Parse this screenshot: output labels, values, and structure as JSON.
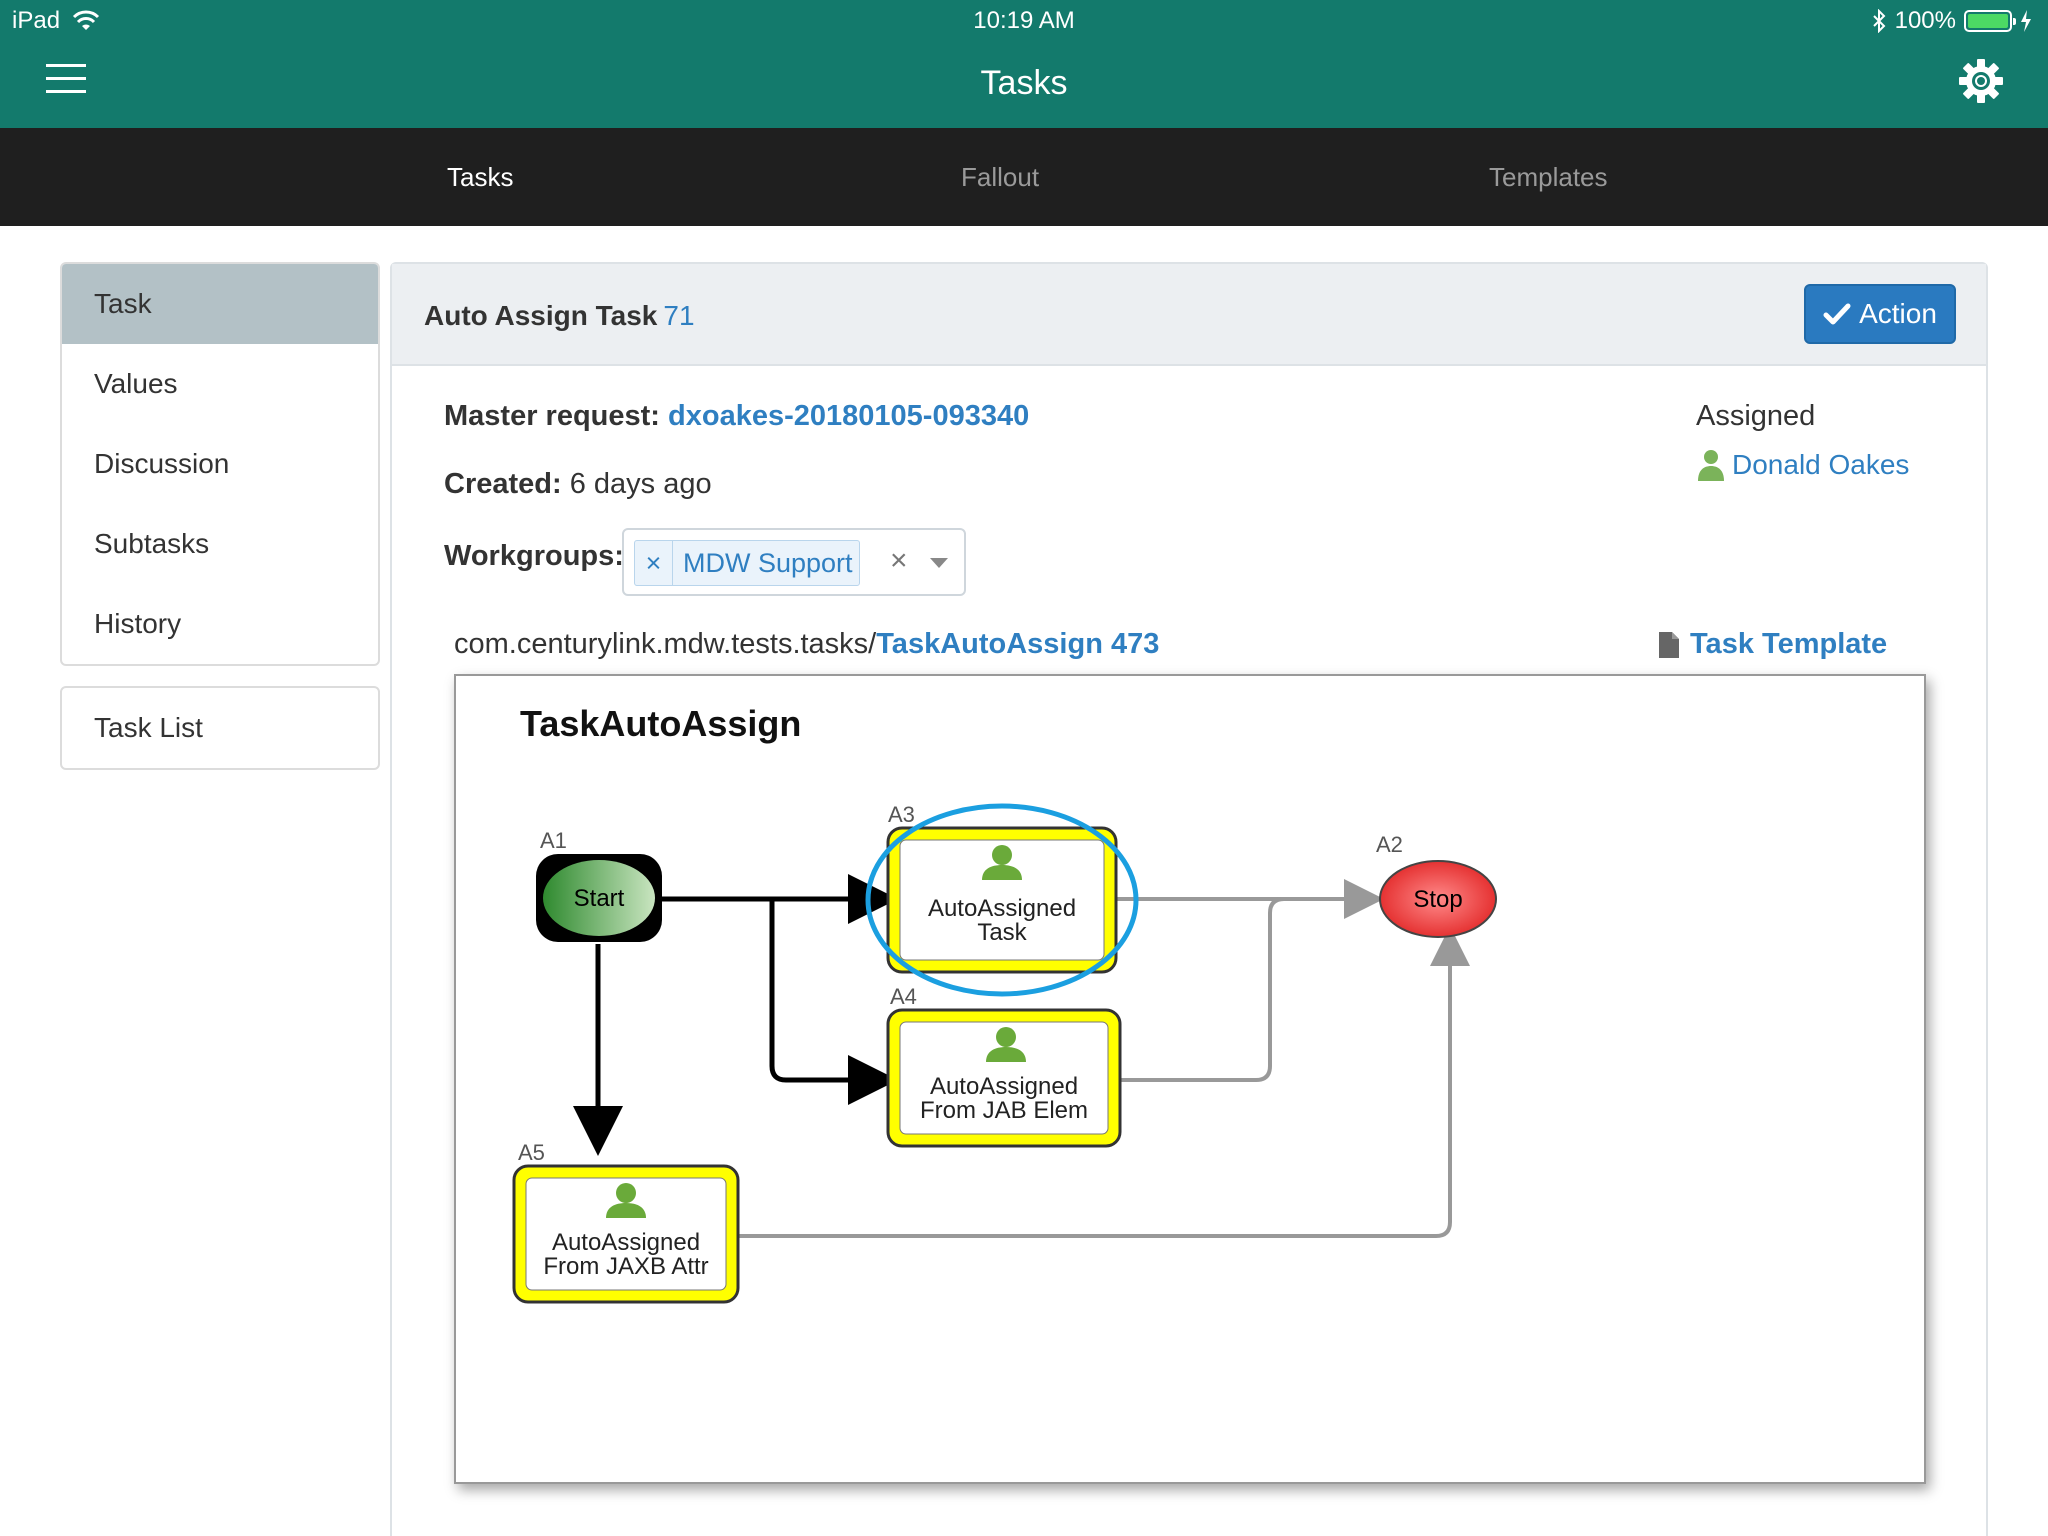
{
  "status_bar": {
    "device": "iPad",
    "time": "10:19 AM",
    "battery": "100%"
  },
  "header": {
    "title": "Tasks"
  },
  "tabs": [
    {
      "label": "Tasks",
      "active": true
    },
    {
      "label": "Fallout",
      "active": false
    },
    {
      "label": "Templates",
      "active": false
    }
  ],
  "sidebar": {
    "items": [
      {
        "label": "Task",
        "active": true
      },
      {
        "label": "Values"
      },
      {
        "label": "Discussion"
      },
      {
        "label": "Subtasks"
      },
      {
        "label": "History"
      }
    ],
    "task_list": "Task List"
  },
  "task": {
    "title": "Auto Assign Task",
    "id": "71",
    "action_label": "Action",
    "master_request_label": "Master request:",
    "master_request": "dxoakes-20180105-093340",
    "created_label": "Created:",
    "created": "6 days ago",
    "workgroups_label": "Workgroups:",
    "workgroup_chip_remove": "×",
    "workgroup": "MDW Support",
    "workgroup_clear": "×",
    "assigned_label": "Assigned",
    "assignee": "Donald Oakes",
    "package_path": "com.centurylink.mdw.tests.tasks/",
    "process_link": "TaskAutoAssign 473",
    "template_link": "Task Template"
  },
  "diagram": {
    "title": "TaskAutoAssign",
    "nodes": [
      {
        "id": "A1",
        "label": "Start"
      },
      {
        "id": "A3",
        "label_line1": "AutoAssigned",
        "label_line2": "Task"
      },
      {
        "id": "A2",
        "label": "Stop"
      },
      {
        "id": "A4",
        "label_line1": "AutoAssigned",
        "label_line2": "From JAB Elem"
      },
      {
        "id": "A5",
        "label_line1": "AutoAssigned",
        "label_line2": "From JAXB Attr"
      }
    ]
  },
  "colors": {
    "header": "#137a6c",
    "tabbar": "#1f1f1f",
    "accent": "#2f7fc1",
    "action": "#2a7ac0",
    "activity_fill": "#ffff00",
    "start_node": "#3c9a3c",
    "stop_node": "#e53030",
    "highlight": "#1b9fe0"
  }
}
